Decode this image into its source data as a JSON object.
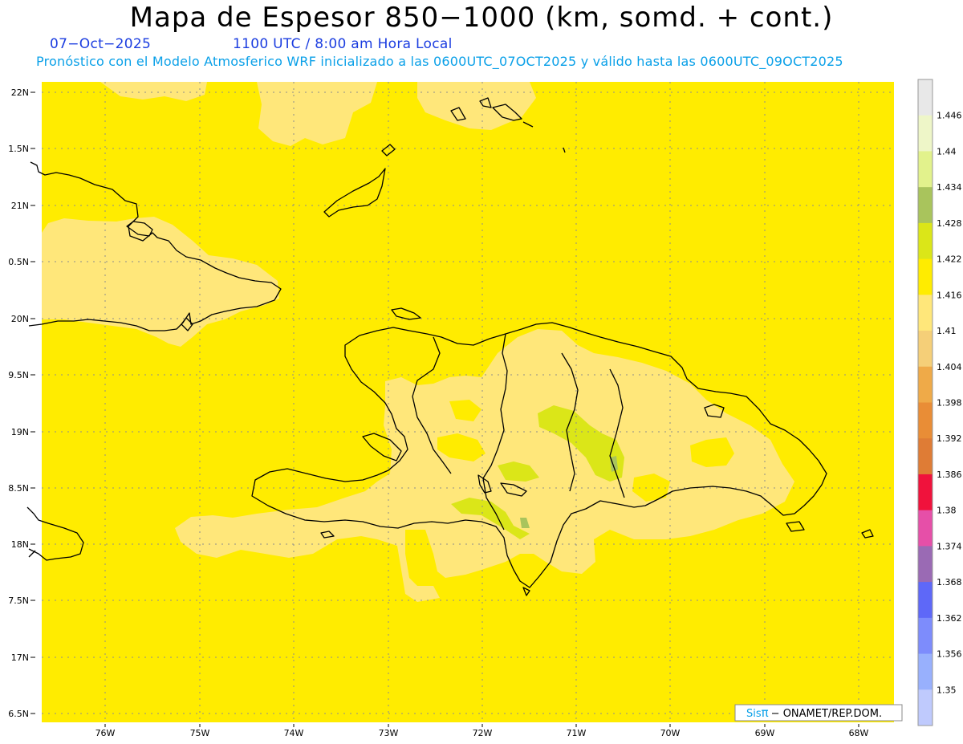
{
  "header": {
    "title": "Mapa de Espesor 850−1000 (km, somd. + cont.)",
    "date": "07−Oct−2025",
    "time": "1100 UTC / 8:00 am Hora Local",
    "forecast": "Pronóstico con el Modelo Atmosferico WRF inicializado a las 0600UTC_07OCT2025 y válido hasta las  0600UTC_09OCT2025"
  },
  "map": {
    "lat_labels": [
      "22N",
      "1.5N",
      "21N",
      "0.5N",
      "20N",
      "9.5N",
      "19N",
      "8.5N",
      "18N",
      "7.5N",
      "17N",
      "6.5N"
    ],
    "lon_labels": [
      "76W",
      "75W",
      "74W",
      "73W",
      "72W",
      "71W",
      "70W",
      "69W",
      "68W"
    ],
    "colors": {
      "base": "#ffec00",
      "light": "#ffe77a",
      "green": "#dbe618",
      "green_dark": "#a9c45c",
      "coast": "#000000",
      "grid": "#888888"
    }
  },
  "colorbar": {
    "labels": [
      "1.446",
      "1.44",
      "1.434",
      "1.428",
      "1.422",
      "1.416",
      "1.41",
      "1.404",
      "1.398",
      "1.392",
      "1.386",
      "1.38",
      "1.374",
      "1.368",
      "1.362",
      "1.356",
      "1.35"
    ],
    "colors": [
      "#e8e8e8",
      "#eef6c8",
      "#e2f28c",
      "#a9c45c",
      "#dbe618",
      "#ffec00",
      "#ffe77a",
      "#f5cf78",
      "#efaa48",
      "#e98d36",
      "#df7c35",
      "#f0123c",
      "#e64fa8",
      "#9a6ab4",
      "#5e68f8",
      "#7d8cfc",
      "#98b0fd",
      "#bfcafd"
    ]
  },
  "credit": {
    "sis": "Sis",
    "pi": "π",
    "rest": "− ONAMET/REP.DOM."
  }
}
